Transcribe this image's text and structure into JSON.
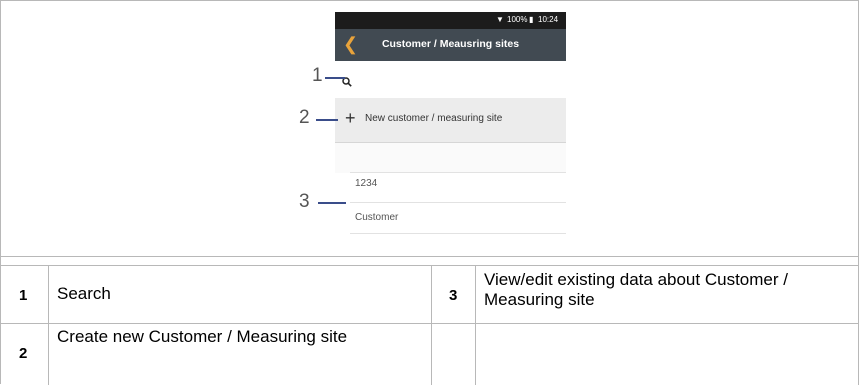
{
  "phone": {
    "status": {
      "signal": "100%",
      "time": "10:24"
    },
    "header_title": "Customer / Meausring sites",
    "back_icon": "chevron-left-icon",
    "search_icon": "magnifier-icon",
    "new_button_label": "New customer / measuring site",
    "entries": [
      "1234",
      "Customer"
    ]
  },
  "callouts": [
    "1",
    "2",
    "3"
  ],
  "legend": [
    {
      "num": "1",
      "text": "Search"
    },
    {
      "num": "3",
      "text": "View/edit existing data about Customer / Measuring site"
    },
    {
      "num": "2",
      "text": "Create new Customer / Measuring site"
    }
  ],
  "colors": {
    "appbar": "#414a52",
    "accent": "#e8a33b",
    "callout_line": "#3a4d8a"
  }
}
